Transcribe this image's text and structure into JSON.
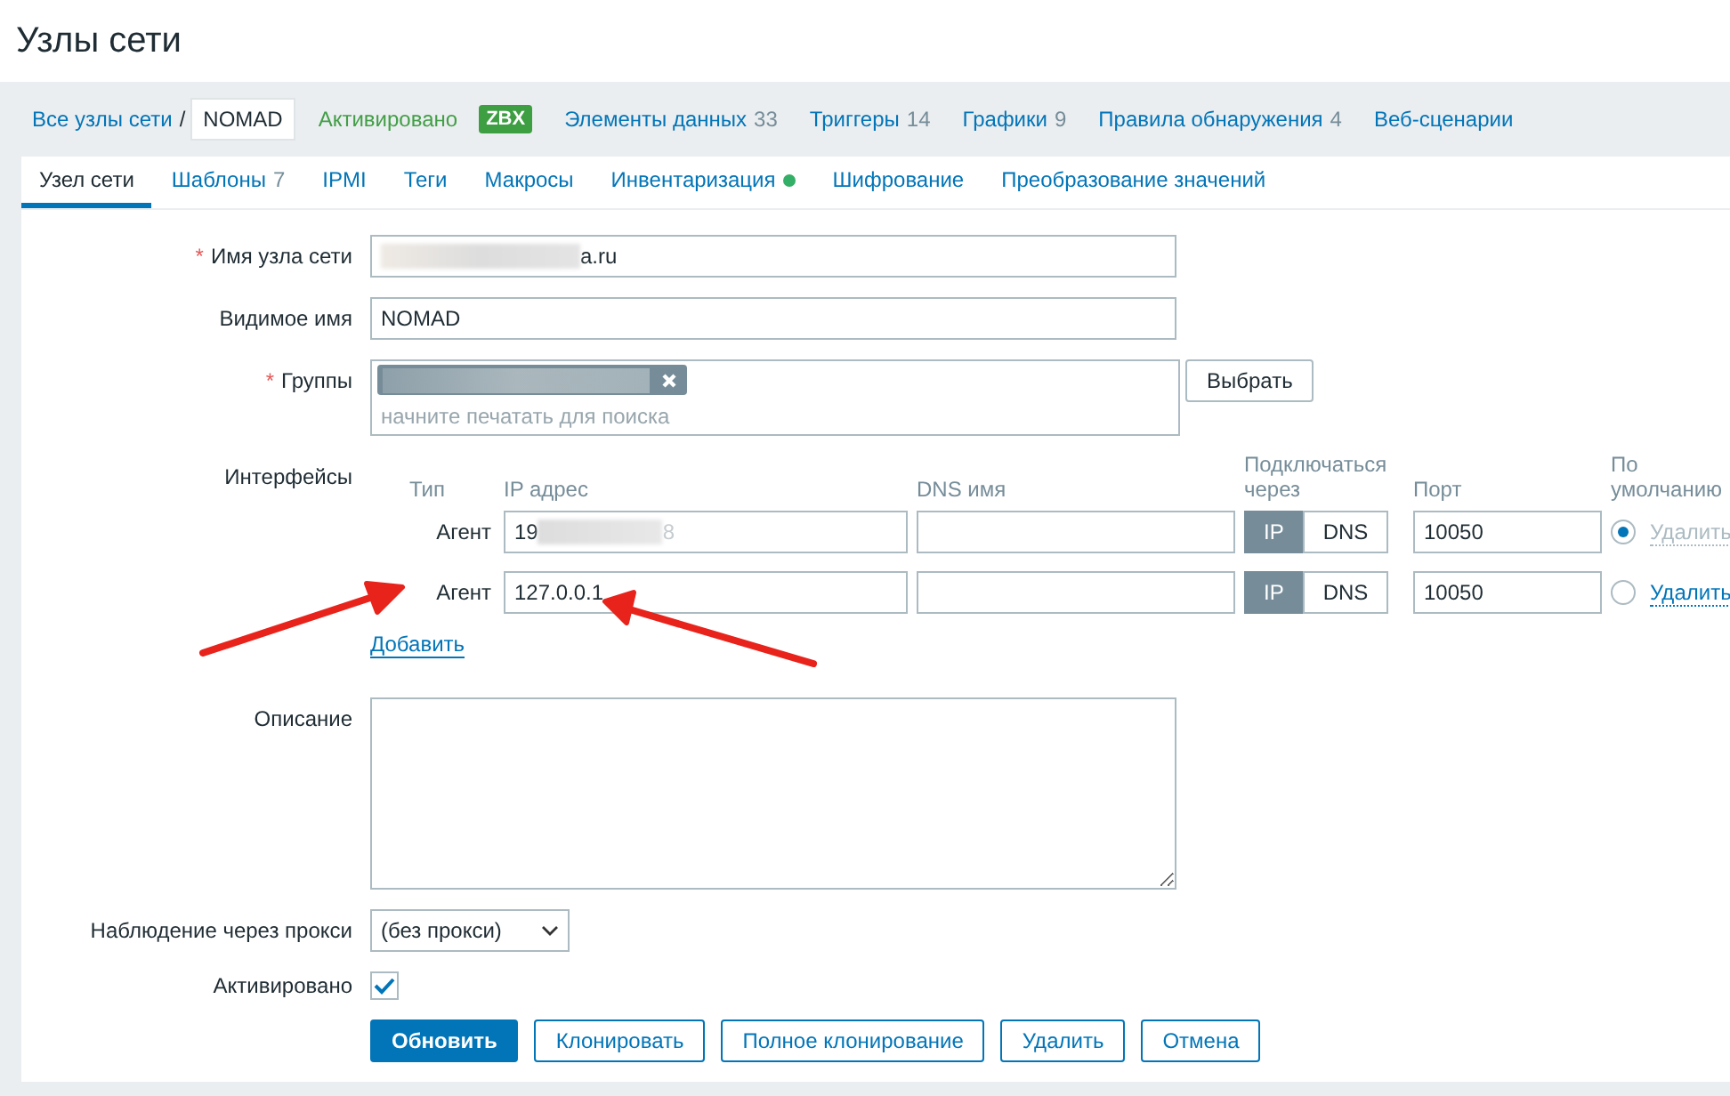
{
  "page_title": "Узлы сети",
  "breadcrumb": {
    "all_hosts": "Все узлы сети",
    "separator": "/",
    "host": "NOMAD",
    "status": "Активировано",
    "badge": "ZBX",
    "links": [
      {
        "label": "Элементы данных",
        "count": "33"
      },
      {
        "label": "Триггеры",
        "count": "14"
      },
      {
        "label": "Графики",
        "count": "9"
      },
      {
        "label": "Правила обнаружения",
        "count": "4"
      },
      {
        "label": "Веб-сценарии"
      }
    ]
  },
  "tabs": [
    {
      "label": "Узел сети",
      "selected": true
    },
    {
      "label": "Шаблоны",
      "count": "7",
      "selected": false
    },
    {
      "label": "IPMI",
      "selected": false
    },
    {
      "label": "Теги",
      "selected": false
    },
    {
      "label": "Макросы",
      "selected": false
    },
    {
      "label": "Инвентаризация",
      "dot": true,
      "selected": false
    },
    {
      "label": "Шифрование",
      "selected": false
    },
    {
      "label": "Преобразование значений",
      "selected": false
    }
  ],
  "form": {
    "host_name": {
      "label": "Имя узла сети",
      "required_mark": "*",
      "value": "a.ru"
    },
    "visible_name": {
      "label": "Видимое имя",
      "value": "NOMAD"
    },
    "groups": {
      "label": "Группы",
      "required_mark": "*",
      "placeholder": "начните печатать для поиска",
      "select_button": "Выбрать"
    },
    "interfaces": {
      "label": "Интерфейсы",
      "columns": [
        "Тип",
        "IP адрес",
        "DNS имя",
        "Подключаться через",
        "Порт",
        "По умолчанию"
      ],
      "rows": [
        {
          "type": "Агент",
          "ip": "19",
          "ip_tail": "8",
          "dns": "",
          "connect": [
            {
              "label": "IP",
              "selected": true
            },
            {
              "label": "DNS",
              "selected": false
            }
          ],
          "port": "10050",
          "default": true,
          "remove": "Удалить"
        },
        {
          "type": "Агент",
          "ip": "127.0.0.1",
          "dns": "",
          "connect": [
            {
              "label": "IP",
              "selected": true
            },
            {
              "label": "DNS",
              "selected": false
            }
          ],
          "port": "10050",
          "default": false,
          "remove": "Удалить"
        }
      ],
      "add": "Добавить"
    },
    "description": {
      "label": "Описание"
    },
    "proxy": {
      "label": "Наблюдение через прокси",
      "value": "(без прокси)"
    },
    "enabled": {
      "label": "Активировано",
      "checked": true
    },
    "buttons": [
      {
        "label": "Обновить",
        "primary": true
      },
      {
        "label": "Клонировать",
        "primary": false
      },
      {
        "label": "Полное клонирование",
        "primary": false
      },
      {
        "label": "Удалить",
        "primary": false
      },
      {
        "label": "Отмена",
        "primary": false
      }
    ]
  }
}
